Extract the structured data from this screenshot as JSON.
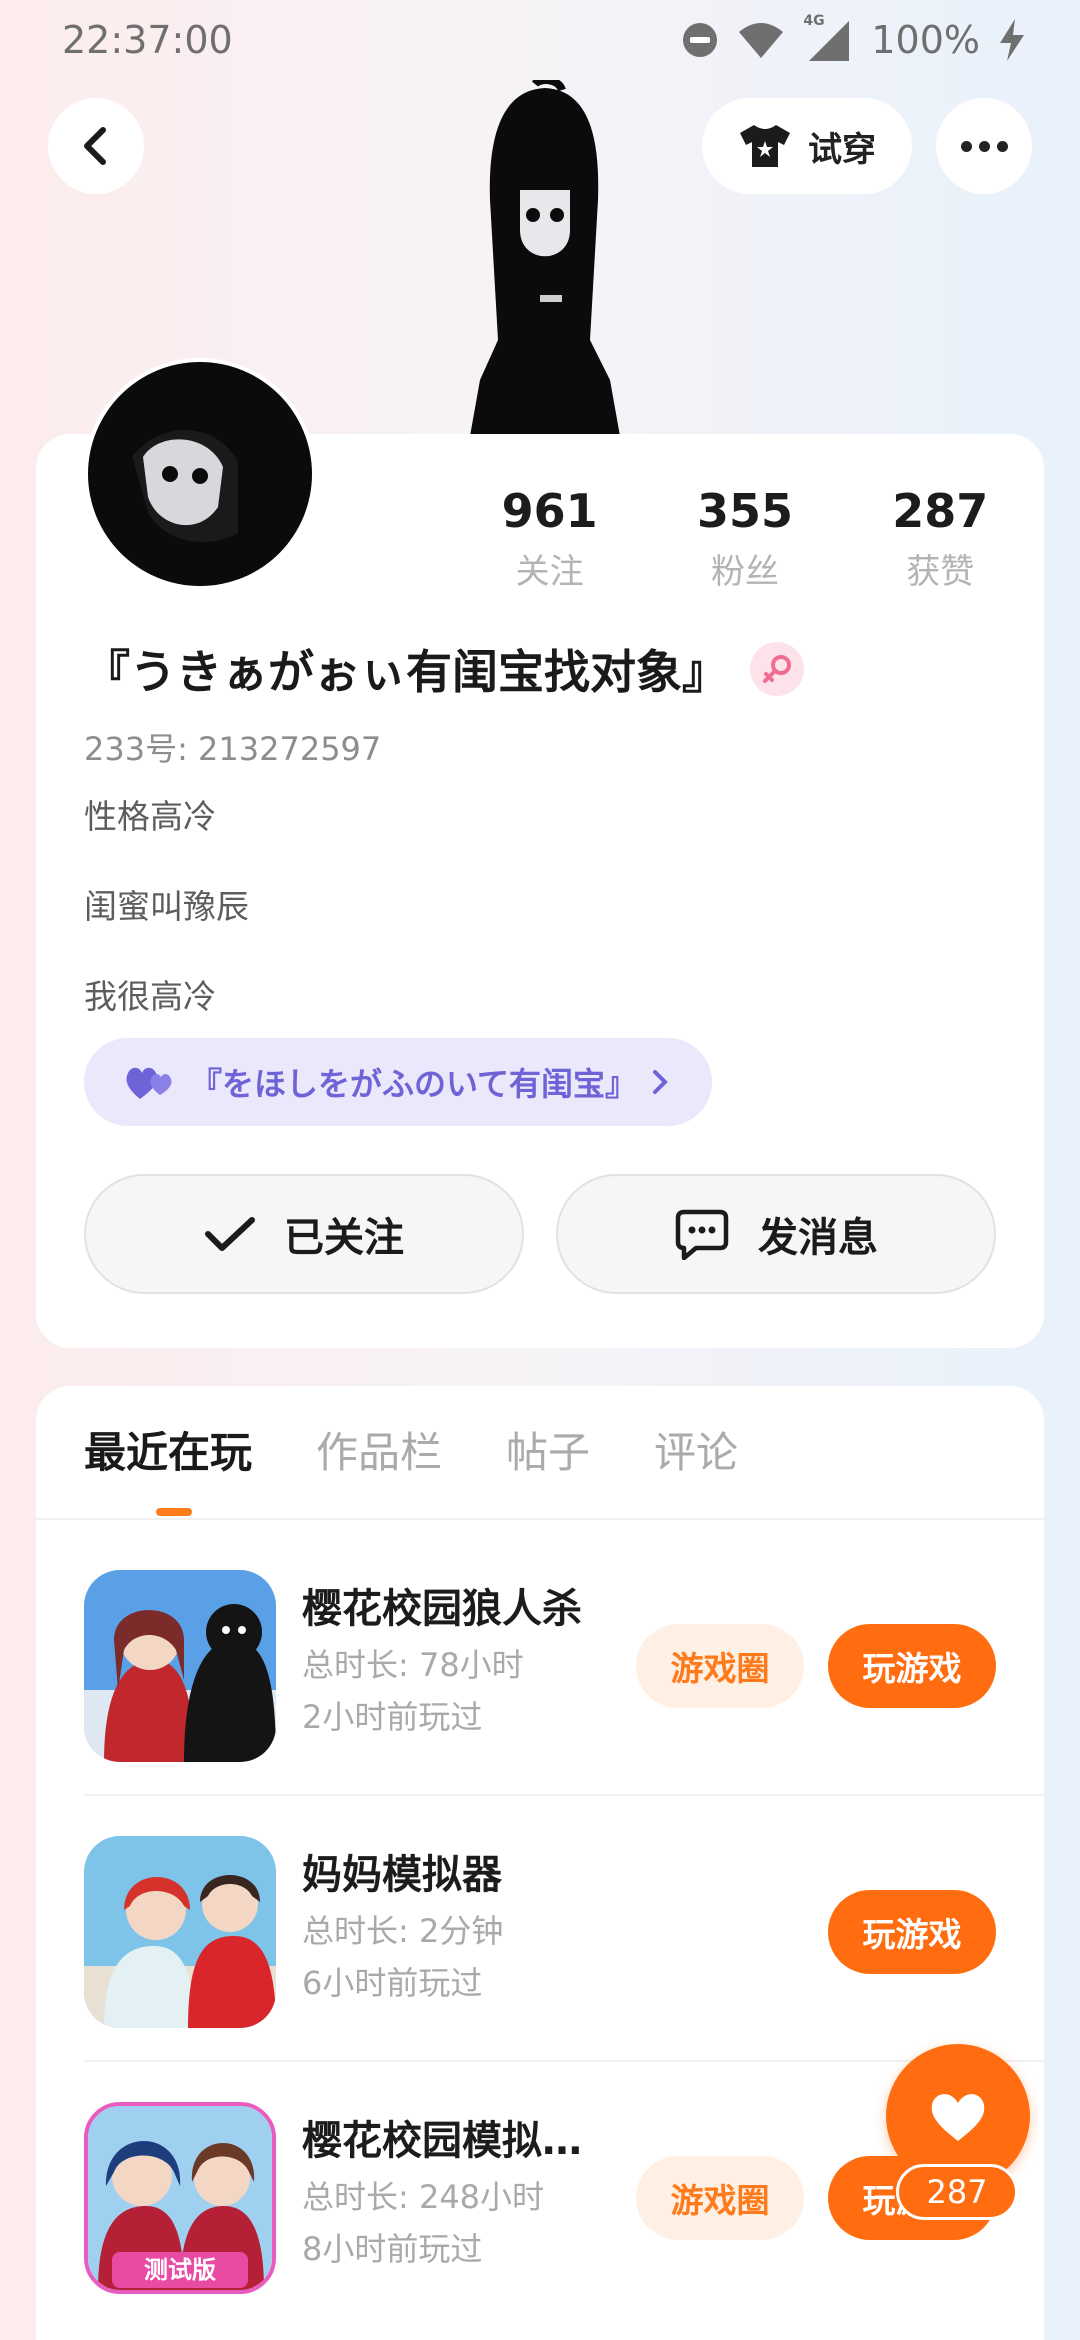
{
  "status_bar": {
    "time": "22:37:00",
    "battery": "100%",
    "network": "4G"
  },
  "header": {
    "tryon_label": "试穿"
  },
  "profile": {
    "stats": [
      {
        "value": "961",
        "label": "关注"
      },
      {
        "value": "355",
        "label": "粉丝"
      },
      {
        "value": "287",
        "label": "获赞"
      }
    ],
    "nickname": "『うきぁがぉぃ有闺宝找对象』",
    "uid": "233号: 213272597",
    "bio": [
      "性格高冷",
      "闺蜜叫豫辰",
      "我很高冷"
    ],
    "bestie_chip": "『をほしをがふのいて有闺宝』",
    "follow_label": "已关注",
    "message_label": "发消息"
  },
  "tabs": [
    {
      "label": "最近在玩",
      "active": true
    },
    {
      "label": "作品栏",
      "active": false
    },
    {
      "label": "帖子",
      "active": false
    },
    {
      "label": "评论",
      "active": false
    }
  ],
  "games": [
    {
      "name": "樱花校园狼人杀",
      "duration": "总时长: 78小时",
      "last_played": "2小时前玩过",
      "circle_label": "游戏圈",
      "play_label": "玩游戏"
    },
    {
      "name": "妈妈模拟器",
      "duration": "总时长: 2分钟",
      "last_played": "6小时前玩过",
      "circle_label": "",
      "play_label": "玩游戏"
    },
    {
      "name": "樱花校园模拟…",
      "duration": "总时长: 248小时",
      "last_played": "8小时前玩过",
      "circle_label": "游戏圈",
      "play_label": "玩游戏"
    }
  ],
  "thumb3_badge": "测试版",
  "like": {
    "count": "287"
  },
  "colors": {
    "accent": "#ff6d10",
    "bestie": "#6f63d8"
  }
}
